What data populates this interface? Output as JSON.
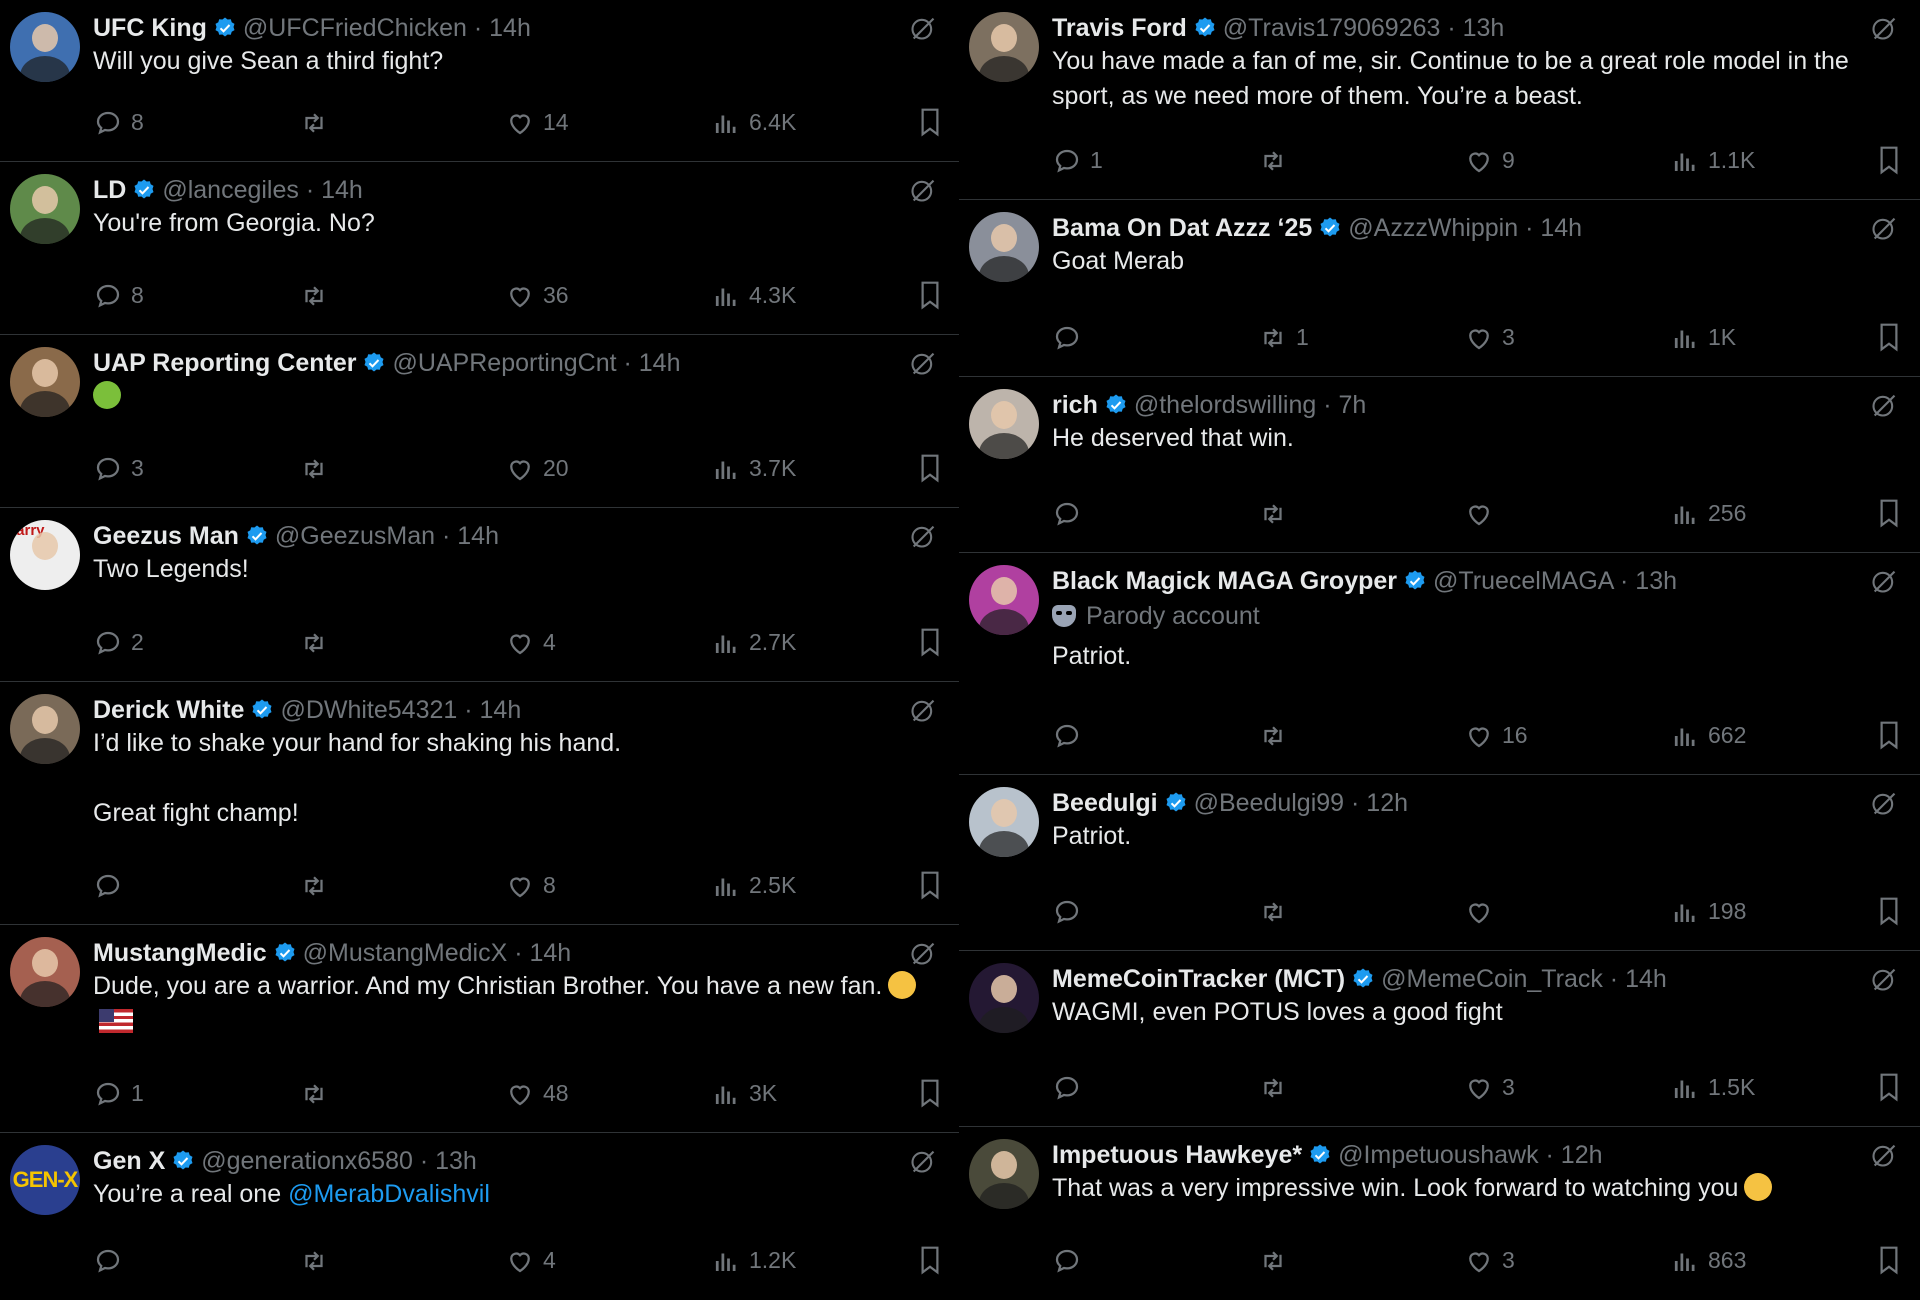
{
  "colors": {
    "background": "#000000",
    "text": "#e7e9ea",
    "muted": "#71767b",
    "accent": "#1d9bf0",
    "divider": "#2f3336"
  },
  "icons": {
    "reply": "reply-bubble-icon",
    "repost": "repost-arrows-icon",
    "like": "heart-icon",
    "views": "bar-chart-icon",
    "bookmark": "bookmark-icon",
    "grok": "grok-slash-icon",
    "verified": "verified-badge-icon",
    "parody": "parody-mask-icon"
  },
  "left_column": {
    "tweets": [
      {
        "name": "UFC King",
        "handle": "@UFCFriedChicken",
        "time": "14h",
        "text": "Will you give Sean a third fight?",
        "replies": "8",
        "reposts": "",
        "likes": "14",
        "views": "6.4K"
      },
      {
        "name": "LD",
        "handle": "@lancegiles",
        "time": "14h",
        "text": "You're from Georgia. No?",
        "replies": "8",
        "reposts": "",
        "likes": "36",
        "views": "4.3K"
      },
      {
        "name": "UAP Reporting Center",
        "handle": "@UAPReportingCnt",
        "time": "14h",
        "text": "",
        "emoji": "nauseated-face",
        "replies": "3",
        "reposts": "",
        "likes": "20",
        "views": "3.7K"
      },
      {
        "name": "Geezus Man",
        "handle": "@GeezusMan",
        "time": "14h",
        "avatar_text": "larry",
        "text": "Two Legends!",
        "replies": "2",
        "reposts": "",
        "likes": "4",
        "views": "2.7K"
      },
      {
        "name": "Derick White",
        "handle": "@DWhite54321",
        "time": "14h",
        "text": "I’d like to shake your hand for shaking his hand.\n\nGreat fight champ!",
        "replies": "",
        "reposts": "",
        "likes": "8",
        "views": "2.5K"
      },
      {
        "name": "MustangMedic",
        "handle": "@MustangMedicX",
        "time": "14h",
        "text": "Dude, you are a warrior. And my Christian Brother. You have a new fan.",
        "emoji": "cowboy-hat-face, us-flag",
        "replies": "1",
        "reposts": "",
        "likes": "48",
        "views": "3K"
      },
      {
        "name": "Gen X",
        "handle": "@generationx6580",
        "time": "13h",
        "avatar_text": "GEN-X",
        "text": "You’re a real one ",
        "mention": "@MerabDvalishvil",
        "replies": "",
        "reposts": "",
        "likes": "4",
        "views": "1.2K"
      }
    ]
  },
  "right_column": {
    "tweets": [
      {
        "name": "Travis Ford",
        "handle": "@Travis179069263",
        "time": "13h",
        "text": "You have made a fan of me, sir. Continue to be a great role model in the sport, as we need more of them. You’re a beast.",
        "replies": "1",
        "reposts": "",
        "likes": "9",
        "views": "1.1K"
      },
      {
        "name": "Bama On Dat Azzz ‘25",
        "handle": "@AzzzWhippin",
        "time": "14h",
        "text": "Goat Merab",
        "replies": "",
        "reposts": "1",
        "likes": "3",
        "views": "1K"
      },
      {
        "name": "rich",
        "handle": "@thelordswilling",
        "time": "7h",
        "text": "He deserved that win.",
        "replies": "",
        "reposts": "",
        "likes": "",
        "views": "256"
      },
      {
        "name": "Black Magick MAGA Groyper",
        "handle": "@TruecelMAGA",
        "time": "13h",
        "parody_label": "Parody account",
        "text": "Patriot.",
        "replies": "",
        "reposts": "",
        "likes": "16",
        "views": "662"
      },
      {
        "name": "Beedulgi",
        "handle": "@Beedulgi99",
        "time": "12h",
        "text": "Patriot.",
        "replies": "",
        "reposts": "",
        "likes": "",
        "views": "198"
      },
      {
        "name": "MemeCoinTracker (MCT)",
        "handle": "@MemeCoin_Track",
        "time": "14h",
        "text": "WAGMI, even POTUS loves a good fight",
        "replies": "",
        "reposts": "",
        "likes": "3",
        "views": "1.5K"
      },
      {
        "name": "Impetuous Hawkeye*",
        "handle": "@Impetuoushawk",
        "time": "12h",
        "text": "That was a very impressive win. Look forward to watching you",
        "emoji": "saluting-face",
        "replies": "",
        "reposts": "",
        "likes": "3",
        "views": "863"
      }
    ]
  }
}
